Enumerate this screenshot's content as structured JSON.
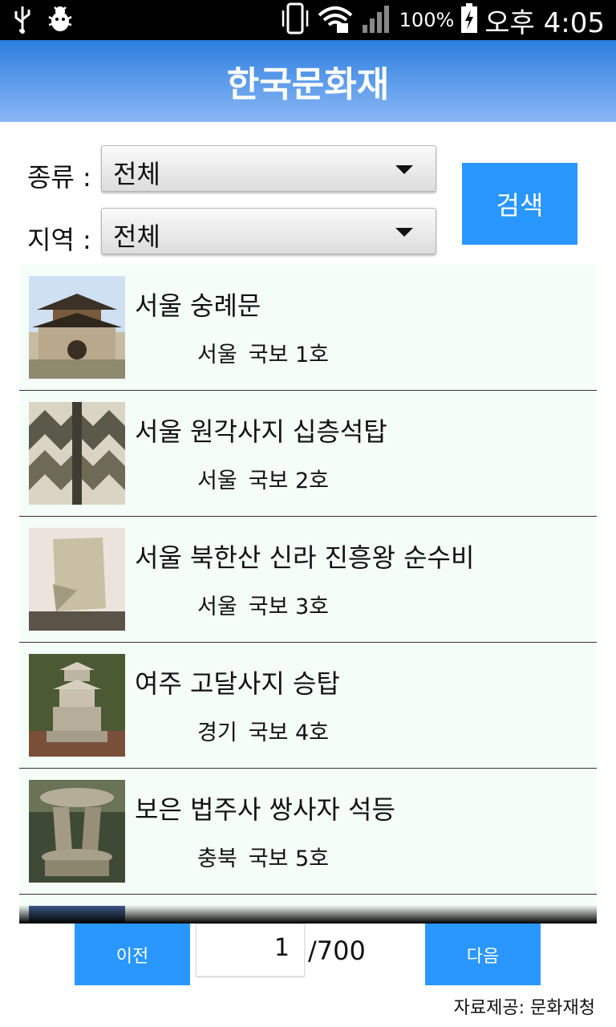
{
  "status_bar": {
    "battery": "100%",
    "time": "오후 4:05"
  },
  "header": {
    "title": "한국문화재"
  },
  "filters": {
    "type_label": "종류 :",
    "type_value": "전체",
    "region_label": "지역 :",
    "region_value": "전체",
    "search_label": "검색"
  },
  "items": [
    {
      "title": "서울 숭례문",
      "region": "서울",
      "designation": "국보 1호"
    },
    {
      "title": "서울 원각사지 십층석탑",
      "region": "서울",
      "designation": "국보 2호"
    },
    {
      "title": "서울 북한산 신라 진흥왕 순수비",
      "region": "서울",
      "designation": "국보 3호"
    },
    {
      "title": "여주 고달사지 승탑",
      "region": "경기",
      "designation": "국보 4호"
    },
    {
      "title": "보은 법주사 쌍사자 석등",
      "region": "충북",
      "designation": "국보 5호"
    }
  ],
  "pagination": {
    "prev_label": "이전",
    "current_page": "1",
    "total": "/700",
    "next_label": "다음"
  },
  "footer": {
    "credit": "자료제공: 문화재청"
  },
  "colors": {
    "accent": "#2997ff",
    "list_bg": "#f5fdf8",
    "header_top": "#2d7fe0",
    "header_bottom": "#8ab7f5"
  }
}
